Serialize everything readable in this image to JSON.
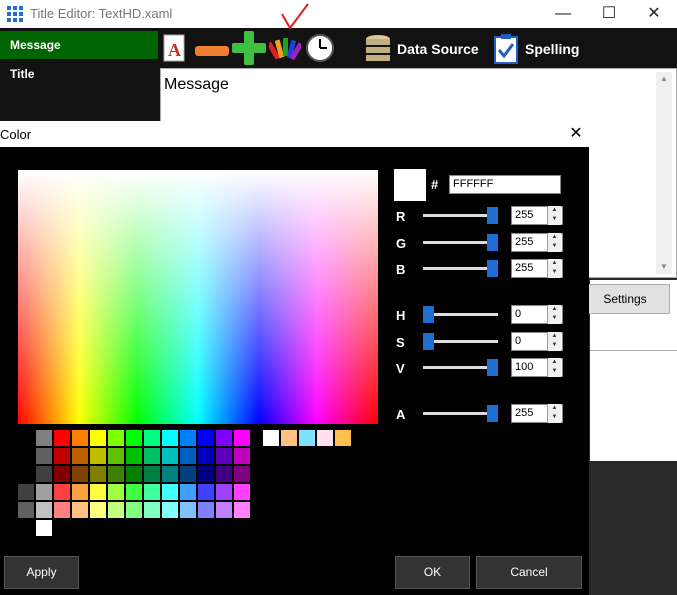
{
  "window": {
    "title": "Title Editor: TextHD.xaml",
    "minimize_label": "—",
    "maximize_label": "☐",
    "close_label": "✕"
  },
  "sidebar": {
    "items": [
      {
        "label": "Message",
        "selected": true
      },
      {
        "label": "Title",
        "selected": false
      }
    ]
  },
  "toolbar": {
    "data_source_label": "Data Source",
    "spelling_label": "Spelling",
    "icons": [
      "text-style-icon",
      "remove-icon",
      "add-icon",
      "color-palette-icon",
      "clock-icon",
      "database-icon",
      "clipboard-check-icon"
    ]
  },
  "editor": {
    "text": "Message"
  },
  "settings_button": "Settings",
  "color_dialog": {
    "title": "Color",
    "close_label": "✕",
    "hash_label": "#",
    "hex_value": "FFFFFF",
    "channels": [
      {
        "key": "R",
        "value": "255",
        "fraction": 1.0
      },
      {
        "key": "G",
        "value": "255",
        "fraction": 1.0
      },
      {
        "key": "B",
        "value": "255",
        "fraction": 1.0
      },
      {
        "key": "H",
        "value": "0",
        "fraction": 0.0
      },
      {
        "key": "S",
        "value": "0",
        "fraction": 0.0
      },
      {
        "key": "V",
        "value": "100",
        "fraction": 1.0
      },
      {
        "key": "A",
        "value": "255",
        "fraction": 1.0
      }
    ],
    "current_color": "#FFFFFF",
    "palette_colors": [
      [
        "#7f7f7f",
        "#ff0000",
        "#ff8000",
        "#ffff00",
        "#80ff00",
        "#00ff00",
        "#00ff80",
        "#00ffff",
        "#0080ff",
        "#0000ff",
        "#8000ff",
        "#ff00ff"
      ],
      [
        "#606060",
        "#bf0000",
        "#bf6000",
        "#bfbf00",
        "#60bf00",
        "#00bf00",
        "#00bf60",
        "#00bfbf",
        "#0060bf",
        "#0000bf",
        "#6000bf",
        "#bf00bf"
      ],
      [
        "#404040",
        "#800000",
        "#804000",
        "#808000",
        "#408000",
        "#008000",
        "#008040",
        "#008080",
        "#004080",
        "#000080",
        "#400080",
        "#800080"
      ],
      [
        "#404040",
        "#a0a0a0",
        "#ff4040",
        "#ffa040",
        "#ffff40",
        "#a0ff40",
        "#40ff40",
        "#40ffa0",
        "#40ffff",
        "#40a0ff",
        "#4040ff",
        "#a040ff",
        "#ff40ff"
      ],
      [
        "#606060",
        "#c0c0c0",
        "#ff8080",
        "#ffc080",
        "#ffff80",
        "#c0ff80",
        "#80ff80",
        "#80ffc0",
        "#80ffff",
        "#80c0ff",
        "#8080ff",
        "#c080ff",
        "#ff80ff"
      ],
      [
        "#ffffff"
      ]
    ],
    "recent_colors": [
      "#ffffff",
      "#ffc080",
      "#80e0ff",
      "#ffe0f0",
      "#ffc050"
    ],
    "apply_label": "Apply",
    "ok_label": "OK",
    "cancel_label": "Cancel"
  }
}
